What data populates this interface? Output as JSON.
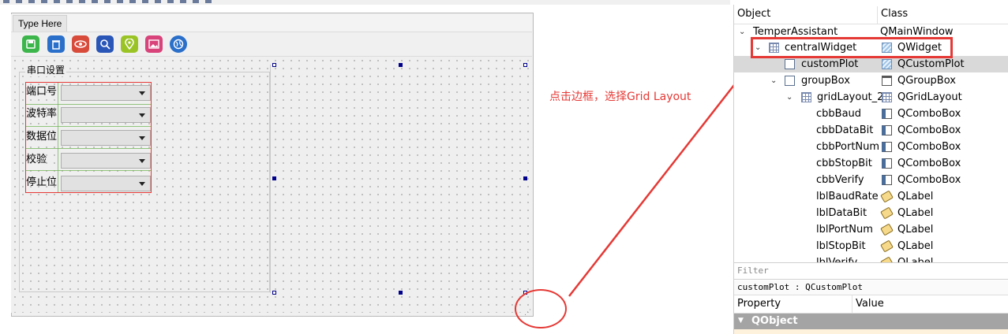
{
  "form": {
    "menu_item": "Type Here",
    "group_title": "串口设置",
    "rows": [
      {
        "label": "端口号"
      },
      {
        "label": "波特率"
      },
      {
        "label": "数据位"
      },
      {
        "label": "校验"
      },
      {
        "label": "停止位"
      }
    ],
    "toolbar_icons": [
      "save-icon",
      "trash-icon",
      "eye-icon",
      "search-icon",
      "location-pin-icon",
      "picture-icon",
      "globe-icon"
    ]
  },
  "annotation": {
    "text": "点击边框，选择Grid Layout",
    "color": "#e53935"
  },
  "object_inspector": {
    "header_object": "Object",
    "header_class": "Class",
    "items": [
      {
        "object": "TemperAssistant",
        "class": "QMainWindow",
        "expanded": true
      },
      {
        "object": "centralWidget",
        "class": "QWidget",
        "expanded": true
      },
      {
        "object": "customPlot",
        "class": "QCustomPlot",
        "selected": true
      },
      {
        "object": "groupBox",
        "class": "QGroupBox",
        "expanded": true
      },
      {
        "object": "gridLayout_2",
        "class": "QGridLayout",
        "expanded": true
      },
      {
        "object": "cbbBaud",
        "class": "QComboBox"
      },
      {
        "object": "cbbDataBit",
        "class": "QComboBox"
      },
      {
        "object": "cbbPortNum",
        "class": "QComboBox"
      },
      {
        "object": "cbbStopBit",
        "class": "QComboBox"
      },
      {
        "object": "cbbVerify",
        "class": "QComboBox"
      },
      {
        "object": "lblBaudRate",
        "class": "QLabel"
      },
      {
        "object": "lblDataBit",
        "class": "QLabel"
      },
      {
        "object": "lblPortNum",
        "class": "QLabel"
      },
      {
        "object": "lblStopBit",
        "class": "QLabel"
      },
      {
        "object": "lblVerify",
        "class": "QLabel"
      }
    ]
  },
  "property_editor": {
    "filter_placeholder": "Filter",
    "selected_object": "customPlot : QCustomPlot",
    "header_property": "Property",
    "header_value": "Value",
    "group": "QObject"
  }
}
